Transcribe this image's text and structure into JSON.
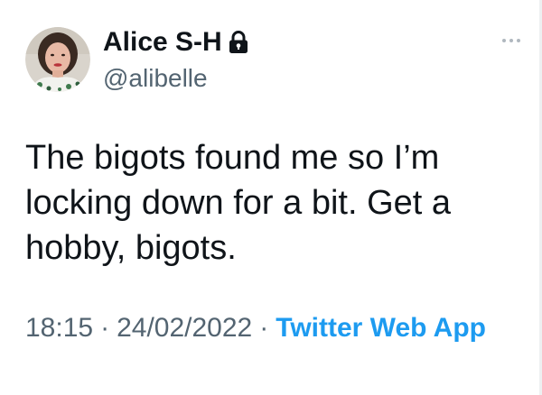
{
  "user": {
    "display_name": "Alice S-H",
    "handle": "@alibelle",
    "protected": true
  },
  "tweet": {
    "text": "The bigots found me so I’m locking down for a bit. Get a hobby, bigots."
  },
  "meta": {
    "time": "18:15",
    "separator": "·",
    "date": "24/02/2022",
    "source": "Twitter Web App"
  },
  "icons": {
    "lock": "lock-icon",
    "more": "more-options-icon"
  },
  "colors": {
    "text_primary": "#0f1419",
    "text_secondary": "#536471",
    "link": "#1d9bf0",
    "background": "#ffffff"
  }
}
